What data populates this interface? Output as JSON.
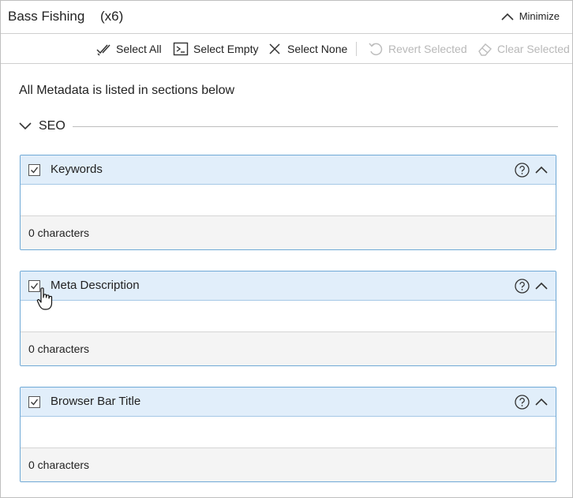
{
  "header": {
    "title": "Bass Fishing",
    "count": "(x6)",
    "minimize_label": "Minimize"
  },
  "toolbar": {
    "select_all": "Select All",
    "select_empty": "Select Empty",
    "select_none": "Select None",
    "revert_selected": "Revert Selected",
    "clear_selected": "Clear Selected"
  },
  "main": {
    "intro": "All Metadata is listed in sections below",
    "section": {
      "title": "SEO",
      "fields": [
        {
          "label": "Keywords",
          "value": "",
          "checked": true,
          "footer": "0 characters"
        },
        {
          "label": "Meta Description",
          "value": "",
          "checked": true,
          "footer": "0 characters"
        },
        {
          "label": "Browser Bar Title",
          "value": "",
          "checked": true,
          "footer": "0 characters"
        }
      ]
    }
  },
  "colors": {
    "card_header_bg": "#e1eefa",
    "card_border": "#6fa9d6",
    "disabled_text": "#b8b8b8"
  }
}
